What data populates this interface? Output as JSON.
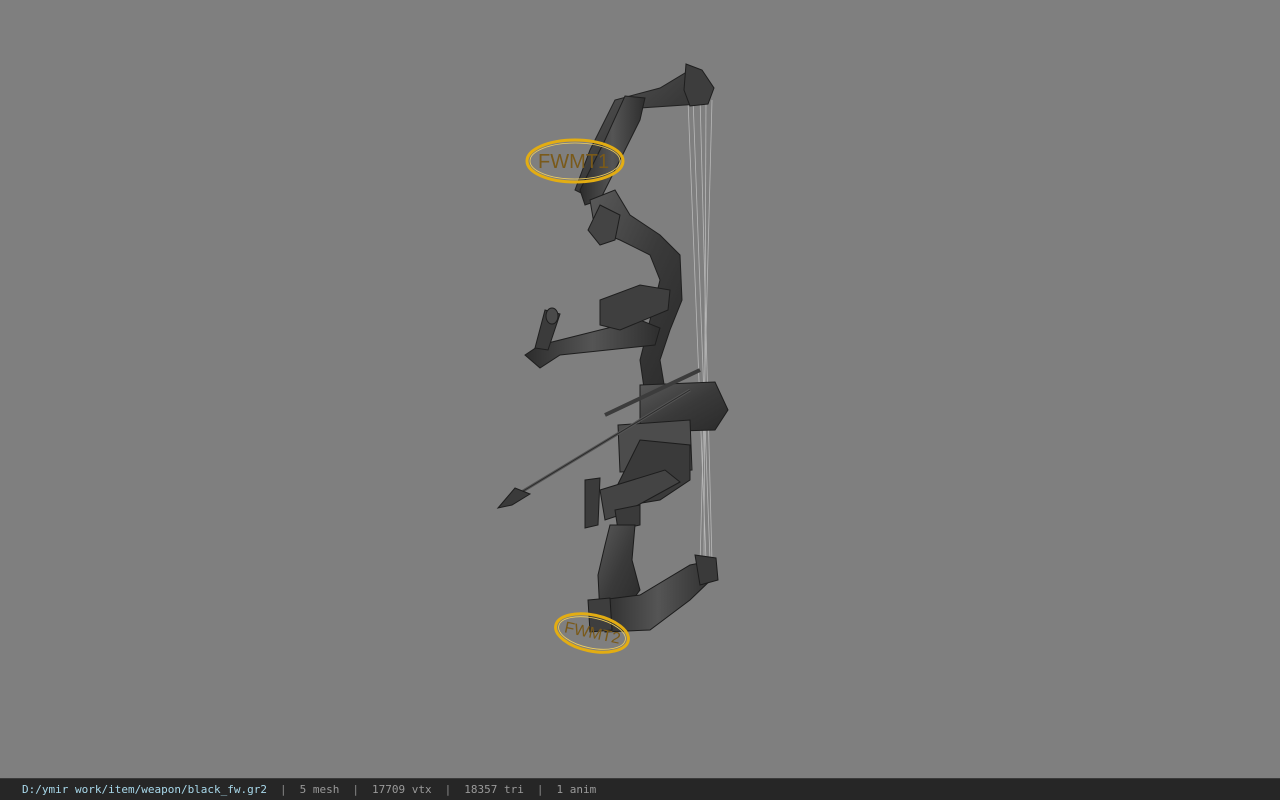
{
  "viewport": {
    "background": "#7f7f7f",
    "model_name": "black_fw",
    "attachment_labels": [
      {
        "text": "FWMT1"
      },
      {
        "text": "FWMT2"
      }
    ],
    "ring_color": "#e0a800",
    "label_color": "#7a5a1a"
  },
  "status_bar": {
    "file_path": "D:/ymir work/item/weapon/black_fw.gr2",
    "separator": "|",
    "mesh_count": "5 mesh",
    "vertex_count": "17709 vtx",
    "triangle_count": "18357 tri",
    "anim_count": "1 anim"
  }
}
